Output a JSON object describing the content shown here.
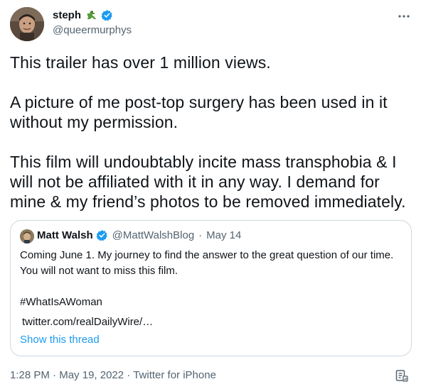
{
  "author": {
    "display_name": "steph",
    "handle": "@queermurphys",
    "emoji": "dinosaur-emoji",
    "verified": true
  },
  "tweet": {
    "paragraphs": [
      "This trailer has over 1 million views.",
      "A picture of me post-top surgery has been used in it without my permission.",
      "This film will undoubtably incite mass transphobia & I will not be affiliated with it in any way. I demand for mine & my friend’s photos to be removed immediately."
    ]
  },
  "quoted": {
    "display_name": "Matt Walsh",
    "handle": "@MattWalshBlog",
    "separator": "·",
    "date": "May 14",
    "text_lines": [
      "Coming June 1. My journey to find the answer to the great question of our time.",
      "You will not want to miss this film."
    ],
    "hashtag": "#WhatIsAWoman",
    "link": "twitter.com/realDailyWire/…",
    "show_thread": "Show this thread"
  },
  "footer": {
    "time": "1:28 PM",
    "separator": "·",
    "date": "May 19, 2022",
    "source": "Twitter for iPhone"
  },
  "colors": {
    "accent": "#1d9bf0",
    "text": "#0f1419",
    "muted": "#536471",
    "border": "#cfd9de"
  }
}
